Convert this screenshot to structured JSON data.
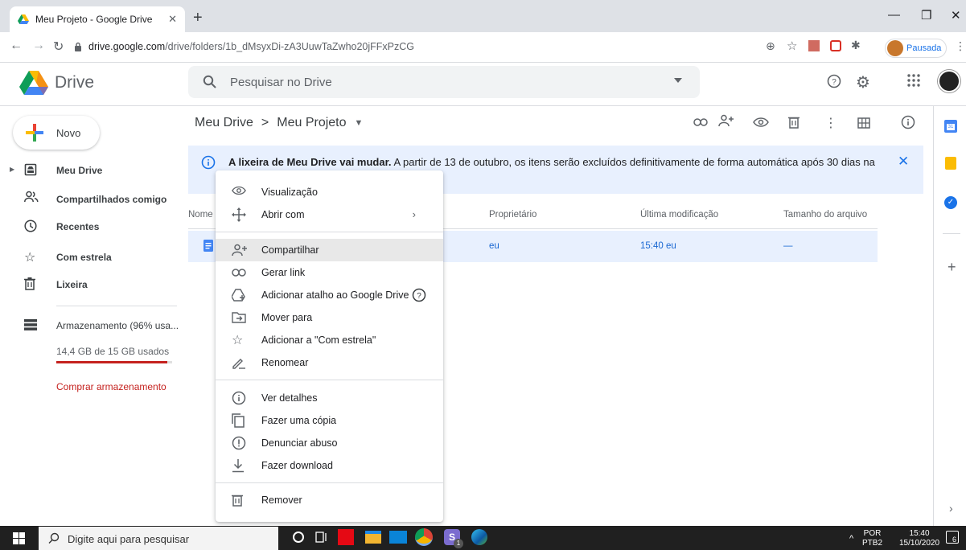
{
  "browser": {
    "tab_title": "Meu Projeto - Google Drive",
    "url_host": "drive.google.com",
    "url_path": "/drive/folders/1b_dMsyxDi-zA3UuwTaZwho20jFFxPzCG",
    "profile_status": "Pausada"
  },
  "header": {
    "app_name": "Drive",
    "search_placeholder": "Pesquisar no Drive"
  },
  "sidebar": {
    "new_label": "Novo",
    "items": [
      {
        "label": "Meu Drive",
        "icon": "drive-icon"
      },
      {
        "label": "Compartilhados comigo",
        "icon": "people-icon"
      },
      {
        "label": "Recentes",
        "icon": "clock-icon"
      },
      {
        "label": "Com estrela",
        "icon": "star-icon"
      },
      {
        "label": "Lixeira",
        "icon": "trash-icon"
      }
    ],
    "storage_label": "Armazenamento (96% usa...",
    "storage_used": "14,4 GB de 15 GB usados",
    "storage_fraction": 0.96,
    "buy_storage": "Comprar armazenamento"
  },
  "main": {
    "breadcrumb": [
      "Meu Drive",
      ">",
      "Meu Projeto"
    ],
    "banner_bold": "A lixeira de Meu Drive vai mudar.",
    "banner_text": " A partir de 13 de outubro, os itens serão excluídos definitivamente de forma automática após 30 dias na",
    "columns": [
      "Nome",
      "Proprietário",
      "Última modificação",
      "Tamanho do arquivo"
    ],
    "row": {
      "owner": "eu",
      "modified": "15:40 eu",
      "size": "—"
    }
  },
  "context_menu": {
    "group1": [
      "Visualização",
      "Abrir com"
    ],
    "group2": [
      "Compartilhar",
      "Gerar link",
      "Adicionar atalho ao Google Drive",
      "Mover para",
      "Adicionar a \"Com estrela\"",
      "Renomear"
    ],
    "group3": [
      "Ver detalhes",
      "Fazer uma cópia",
      "Denunciar abuso",
      "Fazer download"
    ],
    "group4": [
      "Remover"
    ]
  },
  "taskbar": {
    "search_placeholder": "Digite aqui para pesquisar",
    "lang": "POR",
    "lang2": "PTB2",
    "time": "15:40",
    "date": "15/10/2020",
    "notif_count": "6"
  },
  "colors": {
    "accent_blue": "#1a73e8",
    "storage_red": "#c5221f",
    "selection_bg": "#e8f0fe"
  }
}
